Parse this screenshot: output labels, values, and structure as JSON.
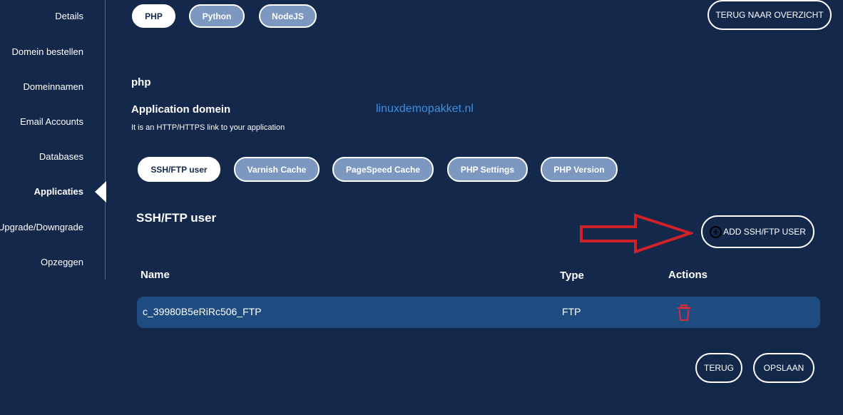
{
  "sidebar": {
    "items": [
      {
        "label": "Details"
      },
      {
        "label": "Domein bestellen"
      },
      {
        "label": "Domeinnamen"
      },
      {
        "label": "Email Accounts"
      },
      {
        "label": "Databases"
      },
      {
        "label": "Applicaties"
      },
      {
        "label": "Upgrade/Downgrade"
      },
      {
        "label": "Opzeggen"
      }
    ],
    "active": "Applicaties"
  },
  "language_tabs": [
    {
      "label": "PHP",
      "active": true
    },
    {
      "label": "Python",
      "active": false
    },
    {
      "label": "NodeJS",
      "active": false
    }
  ],
  "back_to_overview_label": "TERUG NAAR OVERZICHT",
  "app": {
    "type_label": "php",
    "domain_heading": "Application domein",
    "domain_value": "linuxdemopakket.nl",
    "domain_hint": "It is an HTTP/HTTPS link to your application"
  },
  "settings_tabs": [
    {
      "label": "SSH/FTP user",
      "active": true
    },
    {
      "label": "Varnish Cache",
      "active": false
    },
    {
      "label": "PageSpeed Cache",
      "active": false
    },
    {
      "label": "PHP Settings",
      "active": false
    },
    {
      "label": "PHP Version",
      "active": false
    }
  ],
  "section": {
    "title": "SSH/FTP user",
    "add_button_label": "ADD SSH/FTP USER"
  },
  "table": {
    "headers": {
      "name": "Name",
      "type": "Type",
      "actions": "Actions"
    },
    "rows": [
      {
        "name": "c_39980B5eRiRc506_FTP",
        "type": "FTP"
      }
    ]
  },
  "footer": {
    "back_label": "TERUG",
    "save_label": "OPSLAAN"
  },
  "colors": {
    "background": "#13284a",
    "row": "#1e4c80",
    "accent_link": "#3d8fe0",
    "arrow": "#d0212a",
    "delete": "#d92c3a"
  },
  "icons": {
    "add": "plus-circle-icon",
    "delete": "trash-icon",
    "annotation": "red-arrow-icon"
  }
}
